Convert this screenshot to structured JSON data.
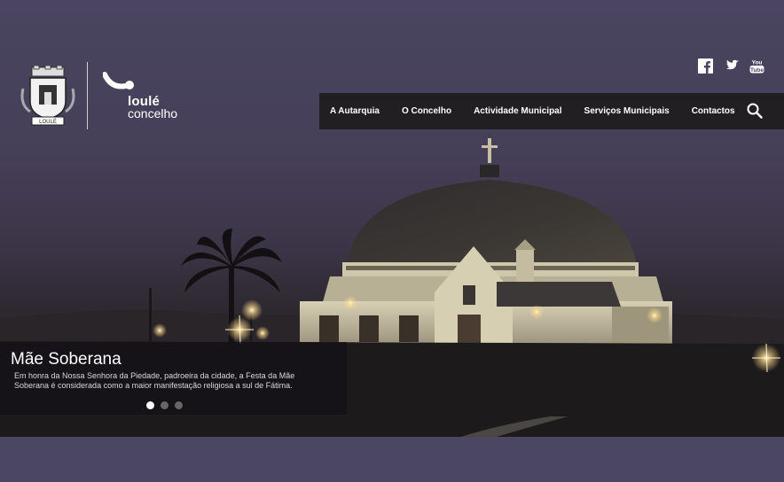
{
  "header": {
    "brand_line1": "loulé",
    "brand_line2": "concelho",
    "coat_of_arms_text": "LOULÉ"
  },
  "social": [
    {
      "name": "facebook-icon"
    },
    {
      "name": "twitter-icon"
    },
    {
      "name": "youtube-icon",
      "text": "You Tube"
    }
  ],
  "nav": {
    "items": [
      {
        "label": "A Autarquia"
      },
      {
        "label": "O Concelho"
      },
      {
        "label": "Actividade Municipal"
      },
      {
        "label": "Serviços Municipais"
      },
      {
        "label": "Contactos"
      }
    ],
    "search_icon": "search-icon"
  },
  "slider": {
    "title": "Mãe Soberana",
    "description": "Em honra da Nossa Senhora da Piedade, padroeira da cidade, a Festa da Mãe Soberana é considerada como a maior manifestação religiosa a sul de Fátima.",
    "slides_count": 3,
    "active_slide": 1
  },
  "colors": {
    "sky": "#4a4560",
    "nav_bg": "#221f23",
    "caption_bg": "#141216"
  }
}
